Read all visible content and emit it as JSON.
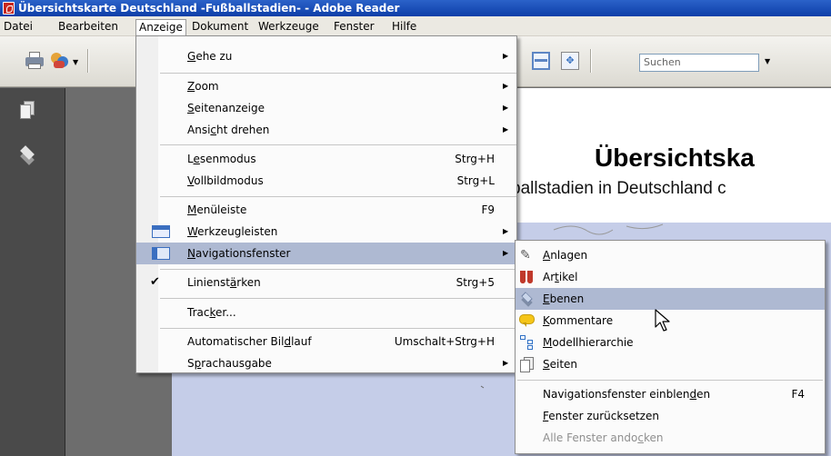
{
  "window": {
    "title": "Übersichtskarte Deutschland -Fußballstadien- - Adobe Reader"
  },
  "menubar": {
    "items": [
      "Datei",
      "Bearbeiten",
      "Anzeige",
      "Dokument",
      "Werkzeuge",
      "Fenster",
      "Hilfe"
    ],
    "active": "Anzeige"
  },
  "toolbar": {
    "search_placeholder": "Suchen"
  },
  "document": {
    "title": "Übersichtska",
    "subtitle": "ballstadien in Deutschland c"
  },
  "anzeige_menu": {
    "items": [
      {
        "pre": "",
        "u": "G",
        "post": "ehe zu",
        "shortcut": "",
        "submenu": true
      },
      {
        "pre": "",
        "u": "Z",
        "post": "oom",
        "shortcut": "",
        "submenu": true
      },
      {
        "pre": "",
        "u": "S",
        "post": "eitenanzeige",
        "shortcut": "",
        "submenu": true
      },
      {
        "pre": "Ansi",
        "u": "c",
        "post": "ht drehen",
        "shortcut": "",
        "submenu": true
      },
      {
        "pre": "L",
        "u": "e",
        "post": "senmodus",
        "shortcut": "Strg+H",
        "submenu": false
      },
      {
        "pre": "",
        "u": "V",
        "post": "ollbildmodus",
        "shortcut": "Strg+L",
        "submenu": false
      },
      {
        "pre": "",
        "u": "M",
        "post": "enüleiste",
        "shortcut": "F9",
        "submenu": false
      },
      {
        "pre": "",
        "u": "W",
        "post": "erkzeugleisten",
        "shortcut": "",
        "submenu": true
      },
      {
        "pre": "",
        "u": "N",
        "post": "avigationsfenster",
        "shortcut": "",
        "submenu": true
      },
      {
        "pre": "Linienst",
        "u": "ä",
        "post": "rken",
        "shortcut": "Strg+5",
        "submenu": false
      },
      {
        "pre": "Trac",
        "u": "k",
        "post": "er...",
        "shortcut": "",
        "submenu": false
      },
      {
        "pre": "Automatischer Bil",
        "u": "d",
        "post": "lauf",
        "shortcut": "Umschalt+Strg+H",
        "submenu": false
      },
      {
        "pre": "S",
        "u": "p",
        "post": "rachausgabe",
        "shortcut": "",
        "submenu": true
      }
    ],
    "check_mark": "✔"
  },
  "nav_submenu": {
    "items": [
      {
        "pre": "",
        "u": "A",
        "post": "nlagen",
        "shortcut": ""
      },
      {
        "pre": "Ar",
        "u": "t",
        "post": "ikel",
        "shortcut": ""
      },
      {
        "pre": "",
        "u": "E",
        "post": "benen",
        "shortcut": ""
      },
      {
        "pre": "",
        "u": "K",
        "post": "ommentare",
        "shortcut": ""
      },
      {
        "pre": "",
        "u": "M",
        "post": "odellhierarchie",
        "shortcut": ""
      },
      {
        "pre": "",
        "u": "S",
        "post": "eiten",
        "shortcut": ""
      },
      {
        "pre": "Navigationsfenster einblen",
        "u": "d",
        "post": "en",
        "shortcut": "F4"
      },
      {
        "pre": "",
        "u": "F",
        "post": "enster zurücksetzen",
        "shortcut": ""
      },
      {
        "pre": "Alle Fenster ando",
        "u": "c",
        "post": "ken",
        "shortcut": ""
      }
    ],
    "highlighted": "Ebenen"
  },
  "colors": {
    "titlebar": "#0d3ea8",
    "menu_highlight": "#aeb9d2",
    "map_water": "#c5cde8",
    "nav_panel": "#4a4a4a"
  }
}
